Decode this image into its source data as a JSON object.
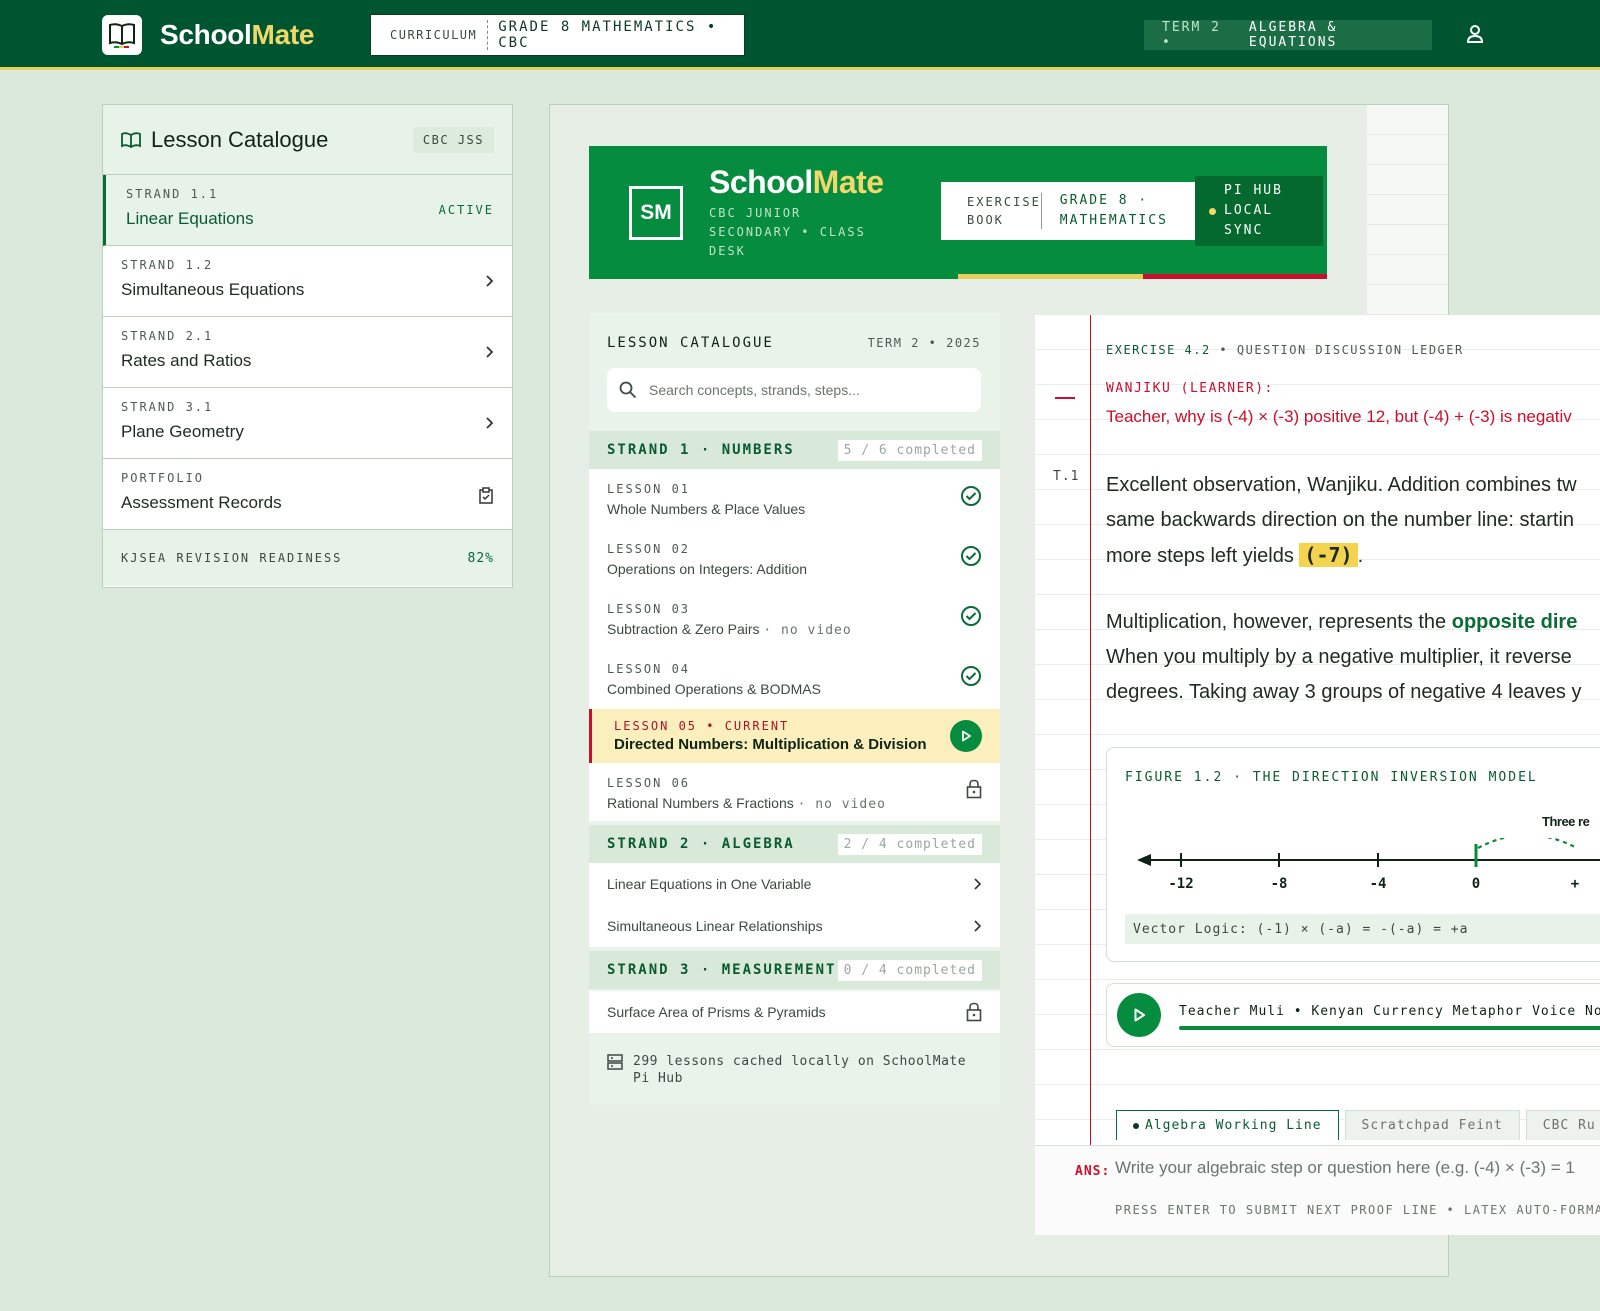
{
  "topbar": {
    "brand_first": "School",
    "brand_second": "Mate",
    "curriculum_label": "CURRICULUM",
    "curriculum_value": "GRADE 8 MATHEMATICS • CBC",
    "term_prefix": "TERM 2 •",
    "term_value": "ALGEBRA & EQUATIONS"
  },
  "left_catalogue": {
    "title": "Lesson Catalogue",
    "tag": "CBC JSS",
    "items": [
      {
        "kicker": "STRAND 1.1",
        "name": "Linear Equations",
        "status": "ACTIVE"
      },
      {
        "kicker": "STRAND 1.2",
        "name": "Simultaneous Equations"
      },
      {
        "kicker": "STRAND 2.1",
        "name": "Rates and Ratios"
      },
      {
        "kicker": "STRAND 3.1",
        "name": "Plane Geometry"
      },
      {
        "kicker": "PORTFOLIO",
        "name": "Assessment Records"
      }
    ],
    "footer_label": "KJSEA REVISION READINESS",
    "footer_value": "82%"
  },
  "banner": {
    "logo": "SM",
    "title_first": "School",
    "title_second": "Mate",
    "subtitle": "CBC JUNIOR SECONDARY • CLASS DESK",
    "book_label": "EXERCISE BOOK",
    "book_value": "GRADE 8 · MATHEMATICS",
    "hub_line1": "PI HUB",
    "hub_line2": "LOCAL",
    "hub_line3": "SYNC",
    "colors": {
      "green": "#068c3f",
      "yellow": "#e6cf5a",
      "red": "#c8102e"
    }
  },
  "catalogue": {
    "title": "LESSON CATALOGUE",
    "term": "TERM 2 • 2025",
    "search_placeholder": "Search concepts, strands, steps...",
    "strand1": {
      "title": "STRAND 1 · NUMBERS",
      "count": "5 / 6 completed",
      "lessons": [
        {
          "kicker": "LESSON 01",
          "name": "Whole Numbers & Place Values"
        },
        {
          "kicker": "LESSON 02",
          "name": "Operations on Integers: Addition"
        },
        {
          "kicker": "LESSON 03",
          "name": "Subtraction & Zero Pairs",
          "note": "· no video"
        },
        {
          "kicker": "LESSON 04",
          "name": "Combined Operations & BODMAS"
        },
        {
          "kicker": "LESSON 05 • CURRENT",
          "name": "Directed Numbers: Multiplication & Division"
        },
        {
          "kicker": "LESSON 06",
          "name": "Rational Numbers & Fractions",
          "note": "· no video"
        }
      ]
    },
    "strand2": {
      "title": "STRAND 2 · ALGEBRA",
      "count": "2 / 4 completed",
      "rows": [
        "Linear Equations in One Variable",
        "Simultaneous Linear Relationships"
      ]
    },
    "strand3": {
      "title": "STRAND 3 · MEASUREMENT",
      "count": "0 / 4 completed",
      "rows": [
        "Surface Area of Prisms & Pyramids"
      ]
    },
    "footer": "299 lessons cached locally on SchoolMate Pi Hub"
  },
  "ledger": {
    "exercise": "EXERCISE 4.2",
    "ledger_title": "QUESTION DISCUSSION LEDGER",
    "learner": "WANJIKU (LEARNER):",
    "question": "Teacher, why is (-4) × (-3) positive 12, but (-4) + (-3) is negativ",
    "t_marker": "T.1",
    "p1_line1": "Excellent observation, Wanjiku. Addition combines tw",
    "p1_line2": "same backwards direction on the number line: startin",
    "p1_line3_pre": "more steps left yields",
    "p1_highlight": "(-7)",
    "p1_line3_post": ".",
    "p2_line1_pre": "Multiplication, however, represents the",
    "p2_strong": "opposite dire",
    "p2_line2": "When you multiply by a negative multiplier, it reverse",
    "p2_line3": "degrees. Taking away 3 groups of negative 4 leaves y",
    "figure_title": "FIGURE 1.2 · THE DIRECTION INVERSION MODEL",
    "figure_label": "Three re",
    "ticks": [
      "-12",
      "-8",
      "-4",
      "0",
      "+"
    ],
    "vector_logic": "Vector Logic: (-1) × (-a) = -(-a) = +a",
    "voice_note": "Teacher Muli • Kenyan Currency Metaphor Voice No",
    "tabs": [
      "Algebra Working Line",
      "Scratchpad Feint",
      "CBC Ru"
    ],
    "ans_label": "ANS:",
    "ans_placeholder": "Write your algebraic step or question here (e.g. (-4) × (-3) = 1",
    "ans_hint": "PRESS ENTER TO SUBMIT NEXT PROOF LINE • LATEX AUTO-FORMAT ENABLED"
  }
}
